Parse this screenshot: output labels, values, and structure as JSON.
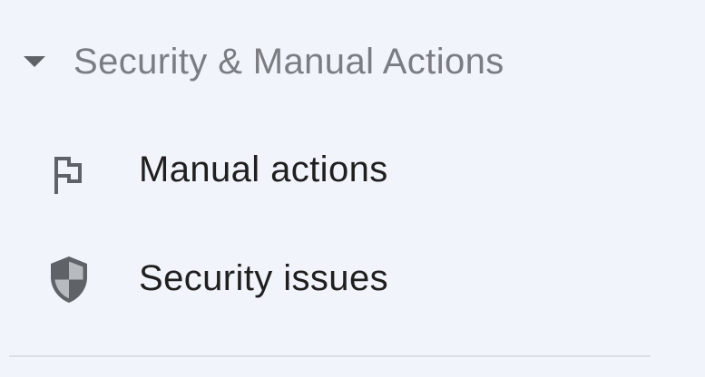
{
  "section": {
    "title": "Security & Manual Actions",
    "expanded": true,
    "toggle_icon": "arrow-drop-down-icon"
  },
  "nav": {
    "items": [
      {
        "label": "Manual actions",
        "icon": "flag-icon"
      },
      {
        "label": "Security issues",
        "icon": "shield-icon"
      }
    ]
  },
  "colors": {
    "background": "#f1f4fb",
    "section_title": "#7a7d81",
    "item_text": "#1f1f1f",
    "icon": "#5f6368",
    "divider": "#dcdfe4"
  }
}
